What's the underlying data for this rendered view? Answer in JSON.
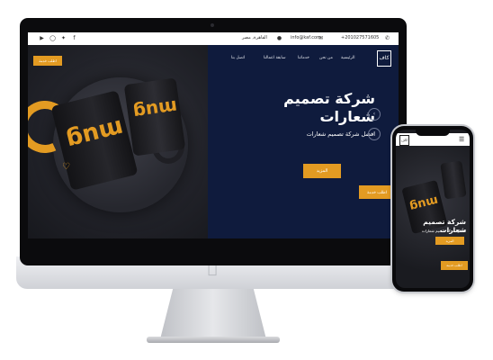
{
  "colors": {
    "navy": "#0f1b3d",
    "accent": "#e39b22",
    "topbar": "#ffffff"
  },
  "topbar": {
    "phone": "+201027571605",
    "email": "info@kaf.com",
    "address": "القاهرة, مصر",
    "icons": [
      "youtube-icon",
      "instagram-icon",
      "twitter-icon",
      "facebook-icon"
    ]
  },
  "nav": {
    "items": [
      "الرئيسية",
      "من نحن",
      "خدماتنا",
      "سابقة اعمالنا",
      "اتصل بنا"
    ]
  },
  "hero": {
    "title": "شركة تصميم شعارات",
    "subtitle": "افضل شركة تصميم شعارات",
    "more_label": "المزيد",
    "order_label": "اطلب خدمة",
    "order_label_left": "اطلب خدمة",
    "mug_text": "mug"
  },
  "phone": {
    "title": "شركة تصميم شعارات",
    "subtitle": "افضل شركة تصميم شعارات",
    "more_label": "المزيد",
    "order_label": "اطلب خدمة",
    "mug_text": "mug"
  }
}
